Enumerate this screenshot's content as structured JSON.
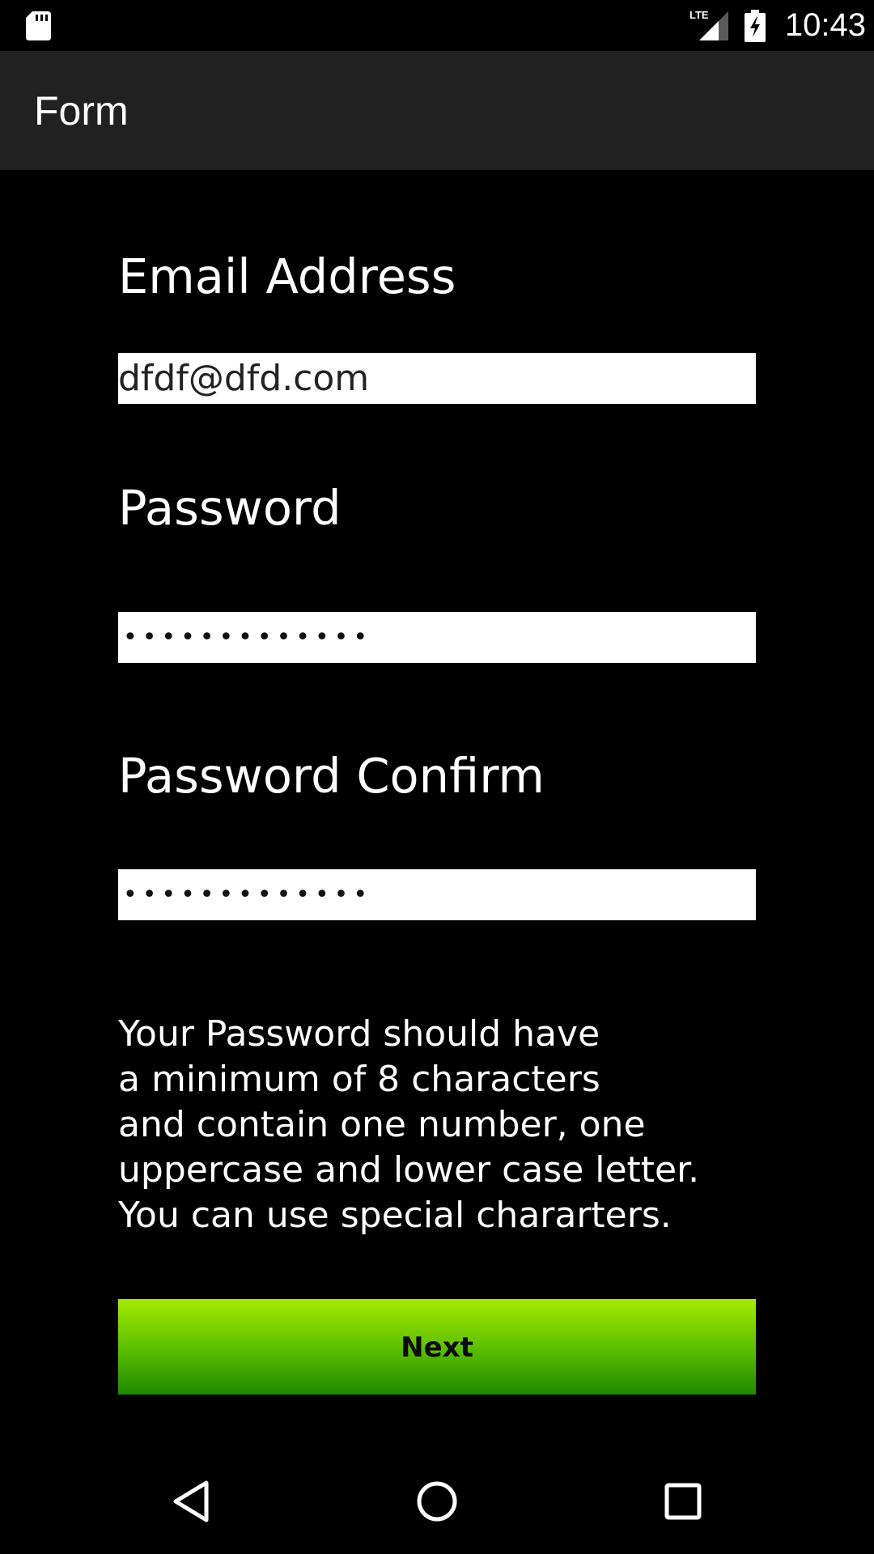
{
  "status_bar": {
    "time": "10:43",
    "network": "LTE",
    "icons": [
      "sd-card-icon",
      "lte-signal-icon",
      "battery-charging-icon"
    ]
  },
  "app_bar": {
    "title": "Form"
  },
  "form": {
    "email": {
      "label": "Email Address",
      "value": "dfdf@dfd.com"
    },
    "password": {
      "label": "Password",
      "masked_value": "•••••••••••••"
    },
    "password_confirm": {
      "label": "Password Confirm",
      "masked_value": "•••••••••••••"
    },
    "hint": "Your Password should have\na minimum of 8 characters\nand contain one number, one\nuppercase and lower case letter.\nYou can use special chararters.",
    "next_label": "Next"
  },
  "colors": {
    "background": "#000000",
    "app_bar": "#212121",
    "button_top": "#a5ea00",
    "button_bottom": "#1e8a00"
  },
  "nav_bar": {
    "icons": [
      "back-icon",
      "home-icon",
      "recents-icon"
    ]
  }
}
